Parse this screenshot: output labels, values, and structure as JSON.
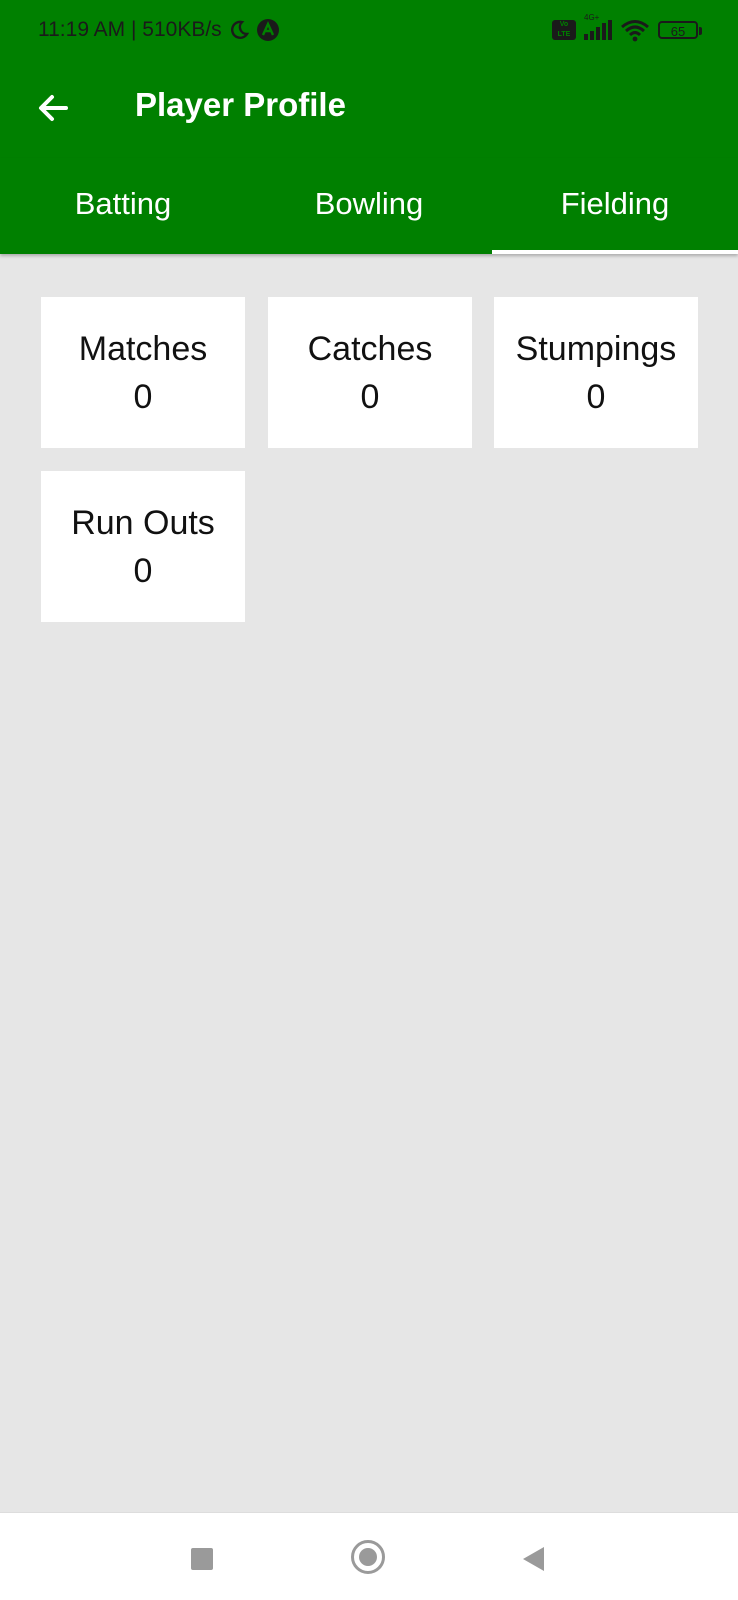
{
  "status_bar": {
    "time_speed": "11:19 AM | 510KB/s",
    "network_tag": "4G+",
    "volte": "Vo LTE",
    "battery": "65"
  },
  "app_bar": {
    "title": "Player Profile"
  },
  "tabs": [
    {
      "label": "Batting",
      "active": false
    },
    {
      "label": "Bowling",
      "active": false
    },
    {
      "label": "Fielding",
      "active": true
    }
  ],
  "fielding_stats": [
    {
      "label": "Matches",
      "value": "0"
    },
    {
      "label": "Catches",
      "value": "0"
    },
    {
      "label": "Stumpings",
      "value": "0"
    },
    {
      "label": "Run Outs",
      "value": "0"
    }
  ],
  "colors": {
    "primary": "#008000",
    "background": "#e6e6e6",
    "card": "#ffffff"
  }
}
